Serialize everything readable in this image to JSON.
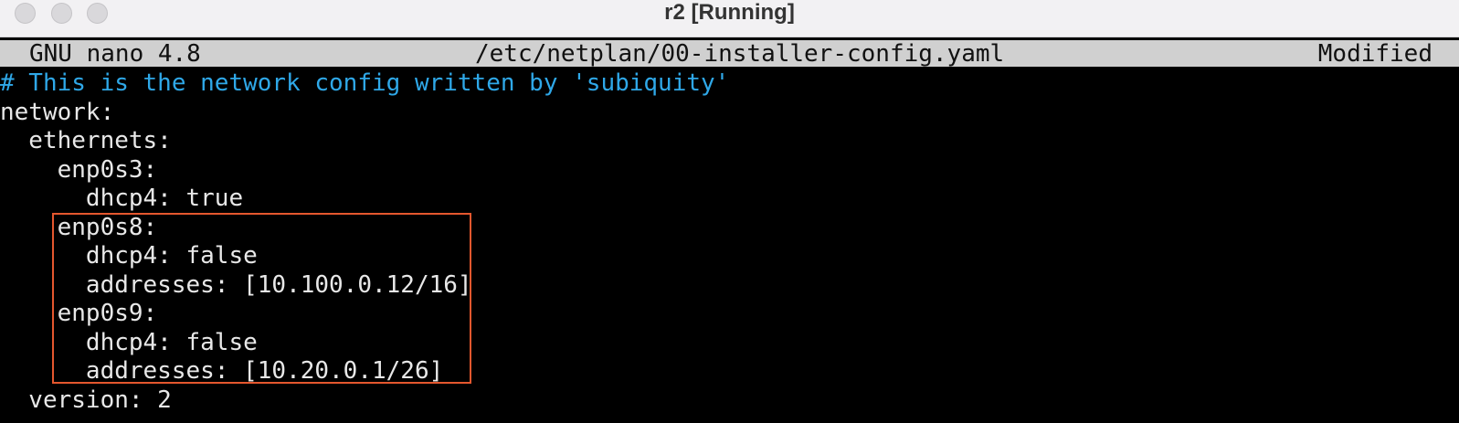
{
  "window": {
    "title": "r2 [Running]"
  },
  "nano": {
    "version_label": "GNU nano 4.8",
    "file_path": "/etc/netplan/00-installer-config.yaml",
    "status": "Modified"
  },
  "editor": {
    "lines": [
      "# This is the network config written by 'subiquity'",
      "network:",
      "  ethernets:",
      "    enp0s3:",
      "      dhcp4: true",
      "    enp0s8:",
      "      dhcp4: false",
      "      addresses: [10.100.0.12/16]",
      "    enp0s9:",
      "      dhcp4: false",
      "      addresses: [10.20.0.1/26]",
      "  version: 2"
    ]
  },
  "colors": {
    "comment": "#2fa8e8",
    "text": "#e8e8e8",
    "highlight_box": "#e4572e",
    "header_bg": "#d0d0d0"
  }
}
